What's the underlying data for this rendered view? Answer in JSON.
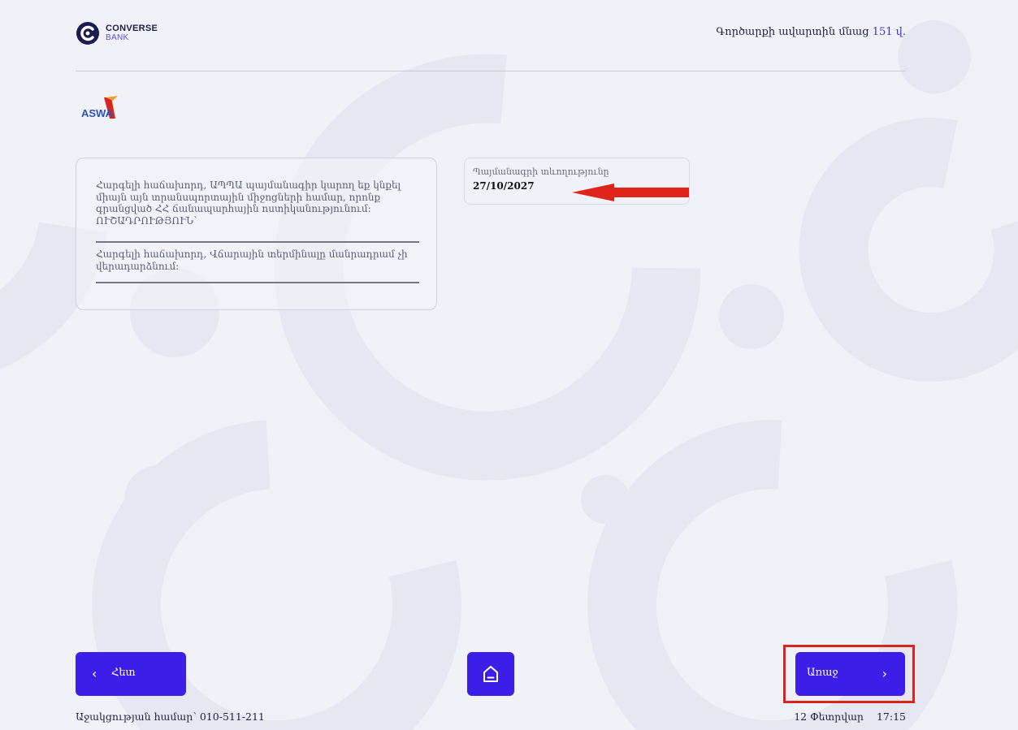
{
  "header": {
    "logo": {
      "line1": "CONVERSE",
      "line2": "BANK"
    },
    "timer": {
      "prefix": "Գործարքի ավարտին մնաց",
      "value": "151 վ."
    }
  },
  "partner_logo": {
    "text": "ASWA"
  },
  "info_card": {
    "message1": "Հարգելի հաճախորդ, ԱՊՊԱ պայմանագիր կարող եք կնքել միայն այն տրանսպորտային միջոցների համար, որոնք գրանցված ՀՀ ճանապարհային ոստիկանությունում: ՈՒՇԱԴՐՈՒԹՅՈՒՆ՝",
    "message2": "Հարգելի հաճախորդ, Վճարային տերմինալը մանրադրամ չի վերադարձնում:"
  },
  "contract": {
    "label": "Պայմանագրի տևողությունը",
    "value": "27/10/2027"
  },
  "buttons": {
    "back": "Հետ",
    "next": "Առաջ"
  },
  "footer": {
    "support": "Աջակցության համար՝ 010-511-211",
    "date": "12 Փետրվար",
    "time": "17:15"
  },
  "colors": {
    "background": "#f1f2f8",
    "primary_button": "#3c1ee8",
    "annotation_red": "#d9251f",
    "accent_text": "#3c32d8"
  },
  "icons": {
    "back": "chevron-left-icon",
    "next": "chevron-right-icon",
    "home": "home-icon",
    "annotation": "red-arrow-icon"
  }
}
